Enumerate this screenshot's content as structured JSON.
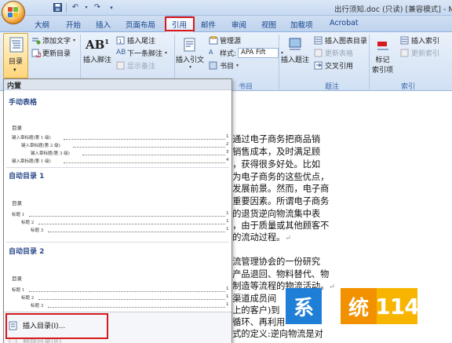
{
  "window": {
    "title": "出行须知.doc (只读) [兼容模式] - Micr",
    "qat": [
      "save-icon",
      "undo-icon",
      "redo-icon",
      "customize-icon"
    ]
  },
  "tabs": [
    "大纲",
    "开始",
    "插入",
    "页面布局",
    "引用",
    "邮件",
    "审阅",
    "视图",
    "加载项",
    "Acrobat"
  ],
  "active_tab": "引用",
  "ribbon": {
    "toc": {
      "label": "目录",
      "add_text": "添加文字",
      "update": "更新目录"
    },
    "footnotes": {
      "insert": "插入脚注",
      "insert_endnote": "插入尾注",
      "next": "下一条脚注",
      "show": "显示备注"
    },
    "citations": {
      "insert": "插入引文",
      "manage": "管理源",
      "style_label": "样式:",
      "style_value": "APA Fift",
      "bibliography": "书目",
      "group": "书目"
    },
    "captions": {
      "insert": "插入题注",
      "insert_table": "插入图表目录",
      "update_table": "更新表格",
      "cross_ref": "交叉引用",
      "group": "题注"
    },
    "index": {
      "mark": "标记",
      "mark2": "索引项",
      "insert": "插入索引",
      "update": "更新索引",
      "group": "索引"
    }
  },
  "gallery": {
    "header": "内置",
    "manual": {
      "name": "手动表格",
      "title": "目录",
      "entries": [
        "键入章标题(第 1 级)",
        "键入章标题(第 2 级)",
        "键入章标题(第 3 级)",
        "键入章标题(第 1 级)"
      ],
      "pages": [
        "1",
        "2",
        "3",
        "4"
      ]
    },
    "auto1": {
      "name": "自动目录 1",
      "title": "目录",
      "entries": [
        "标题 1",
        "标题 2",
        "标题 3"
      ],
      "pages": [
        "1",
        "1",
        "1"
      ]
    },
    "auto2": {
      "name": "自动目录 2",
      "title": "目录",
      "entries": [
        "标题 1",
        "标题 2",
        "标题 3"
      ],
      "pages": [
        "1",
        "1",
        "1"
      ]
    },
    "insert_toc": "插入目录(I)...",
    "delete_toc": "删除目录(R)"
  },
  "document": {
    "paragraphs": [
      "业通过电子商务把商品销",
      "低销售成本，及时满足顾",
      "品，获得很多好处。比如",
      "因为电子商务的这些优点，",
      "的发展前景。然而，电子商",
      "个重要因素。所谓电子商务",
      "务的退货逆向物流集中表",
      "品，由于质量或其他顾客不",
      "商的流动过程。",
      "",
      "物流管理协会的一份研究",
      "了产品退回、物料替代、物",
      "再制造等流程的物流活动。",
      "在渠道成员间",
      "链上的客户)到",
      "再循环、再利用",
      "",
      "正式的定义:逆向物流是对"
    ]
  },
  "watermark": {
    "chars": [
      "系",
      "统",
      "114"
    ],
    "colors": [
      "#1f7fd6",
      "#f29100",
      "#f7b500"
    ]
  }
}
